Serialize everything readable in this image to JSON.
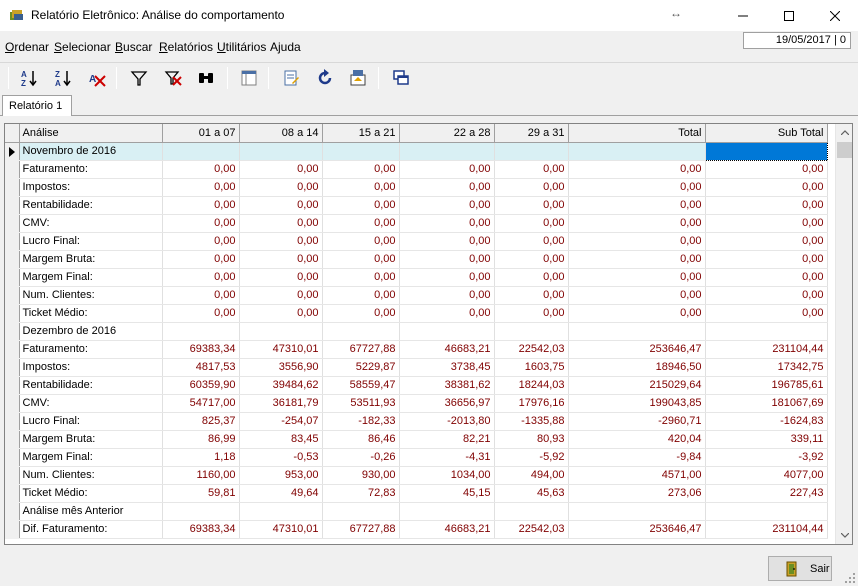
{
  "window": {
    "title": "Relatório Eletrônico: Análise do comportamento",
    "resize_glyph": "↔"
  },
  "menu": [
    {
      "accel": "O",
      "rest": "rdenar"
    },
    {
      "accel": "S",
      "rest": "elecionar"
    },
    {
      "accel": "B",
      "rest": "uscar"
    },
    {
      "accel": "R",
      "rest": "elatórios"
    },
    {
      "accel": "U",
      "rest": "tilitários"
    },
    {
      "accel": "",
      "rest": "Ajuda"
    }
  ],
  "status": {
    "date": "19/05/2017 | 0"
  },
  "toolbar": {
    "icons": [
      "sort-ascending-icon",
      "sort-descending-icon",
      "clear-sort-icon",
      "filter-icon",
      "clear-filter-icon",
      "binoculars-icon",
      "layout-icon",
      "edit-document-icon",
      "refresh-icon",
      "export-icon",
      "windows-icon"
    ]
  },
  "tabs": [
    {
      "label": "Relatório 1"
    }
  ],
  "grid": {
    "columns": [
      "Análise",
      "01 a 07",
      "08 a 14",
      "15 a 21",
      "22 a 28",
      "29 a 31",
      "Total",
      "Sub Total"
    ],
    "rows": [
      {
        "type": "group",
        "label": "Novembro de 2016",
        "selected": true
      },
      {
        "type": "data",
        "label": "Faturamento:",
        "values": [
          "0,00",
          "0,00",
          "0,00",
          "0,00",
          "0,00",
          "0,00",
          "0,00"
        ]
      },
      {
        "type": "data",
        "label": "Impostos:",
        "values": [
          "0,00",
          "0,00",
          "0,00",
          "0,00",
          "0,00",
          "0,00",
          "0,00"
        ]
      },
      {
        "type": "data",
        "label": "Rentabilidade:",
        "values": [
          "0,00",
          "0,00",
          "0,00",
          "0,00",
          "0,00",
          "0,00",
          "0,00"
        ]
      },
      {
        "type": "data",
        "label": "CMV:",
        "values": [
          "0,00",
          "0,00",
          "0,00",
          "0,00",
          "0,00",
          "0,00",
          "0,00"
        ]
      },
      {
        "type": "data",
        "label": "Lucro Final:",
        "values": [
          "0,00",
          "0,00",
          "0,00",
          "0,00",
          "0,00",
          "0,00",
          "0,00"
        ]
      },
      {
        "type": "data",
        "label": "Margem Bruta:",
        "values": [
          "0,00",
          "0,00",
          "0,00",
          "0,00",
          "0,00",
          "0,00",
          "0,00"
        ]
      },
      {
        "type": "data",
        "label": "Margem Final:",
        "values": [
          "0,00",
          "0,00",
          "0,00",
          "0,00",
          "0,00",
          "0,00",
          "0,00"
        ]
      },
      {
        "type": "data",
        "label": "Num. Clientes:",
        "values": [
          "0,00",
          "0,00",
          "0,00",
          "0,00",
          "0,00",
          "0,00",
          "0,00"
        ]
      },
      {
        "type": "data",
        "label": "Ticket Médio:",
        "values": [
          "0,00",
          "0,00",
          "0,00",
          "0,00",
          "0,00",
          "0,00",
          "0,00"
        ]
      },
      {
        "type": "group",
        "label": "Dezembro de 2016"
      },
      {
        "type": "data",
        "label": "Faturamento:",
        "values": [
          "69383,34",
          "47310,01",
          "67727,88",
          "46683,21",
          "22542,03",
          "253646,47",
          "231104,44"
        ]
      },
      {
        "type": "data",
        "label": "Impostos:",
        "values": [
          "4817,53",
          "3556,90",
          "5229,87",
          "3738,45",
          "1603,75",
          "18946,50",
          "17342,75"
        ]
      },
      {
        "type": "data",
        "label": "Rentabilidade:",
        "values": [
          "60359,90",
          "39484,62",
          "58559,47",
          "38381,62",
          "18244,03",
          "215029,64",
          "196785,61"
        ]
      },
      {
        "type": "data",
        "label": "CMV:",
        "values": [
          "54717,00",
          "36181,79",
          "53511,93",
          "36656,97",
          "17976,16",
          "199043,85",
          "181067,69"
        ]
      },
      {
        "type": "data",
        "label": "Lucro Final:",
        "values": [
          "825,37",
          "-254,07",
          "-182,33",
          "-2013,80",
          "-1335,88",
          "-2960,71",
          "-1624,83"
        ]
      },
      {
        "type": "data",
        "label": "Margem Bruta:",
        "values": [
          "86,99",
          "83,45",
          "86,46",
          "82,21",
          "80,93",
          "420,04",
          "339,11"
        ]
      },
      {
        "type": "data",
        "label": "Margem Final:",
        "values": [
          "1,18",
          "-0,53",
          "-0,26",
          "-4,31",
          "-5,92",
          "-9,84",
          "-3,92"
        ]
      },
      {
        "type": "data",
        "label": "Num. Clientes:",
        "values": [
          "1160,00",
          "953,00",
          "930,00",
          "1034,00",
          "494,00",
          "4571,00",
          "4077,00"
        ]
      },
      {
        "type": "data",
        "label": "Ticket Médio:",
        "values": [
          "59,81",
          "49,64",
          "72,83",
          "45,15",
          "45,63",
          "273,06",
          "227,43"
        ]
      },
      {
        "type": "group",
        "label": "Análise mês Anterior"
      },
      {
        "type": "data",
        "label": "Dif. Faturamento:",
        "values": [
          "69383,34",
          "47310,01",
          "67727,88",
          "46683,21",
          "22542,03",
          "253646,47",
          "231104,44"
        ]
      }
    ]
  },
  "footer": {
    "exit_label": "Sair"
  },
  "colors": {
    "value_text": "#800000",
    "selection": "#0078d7",
    "selected_row": "#d9f0f4"
  }
}
